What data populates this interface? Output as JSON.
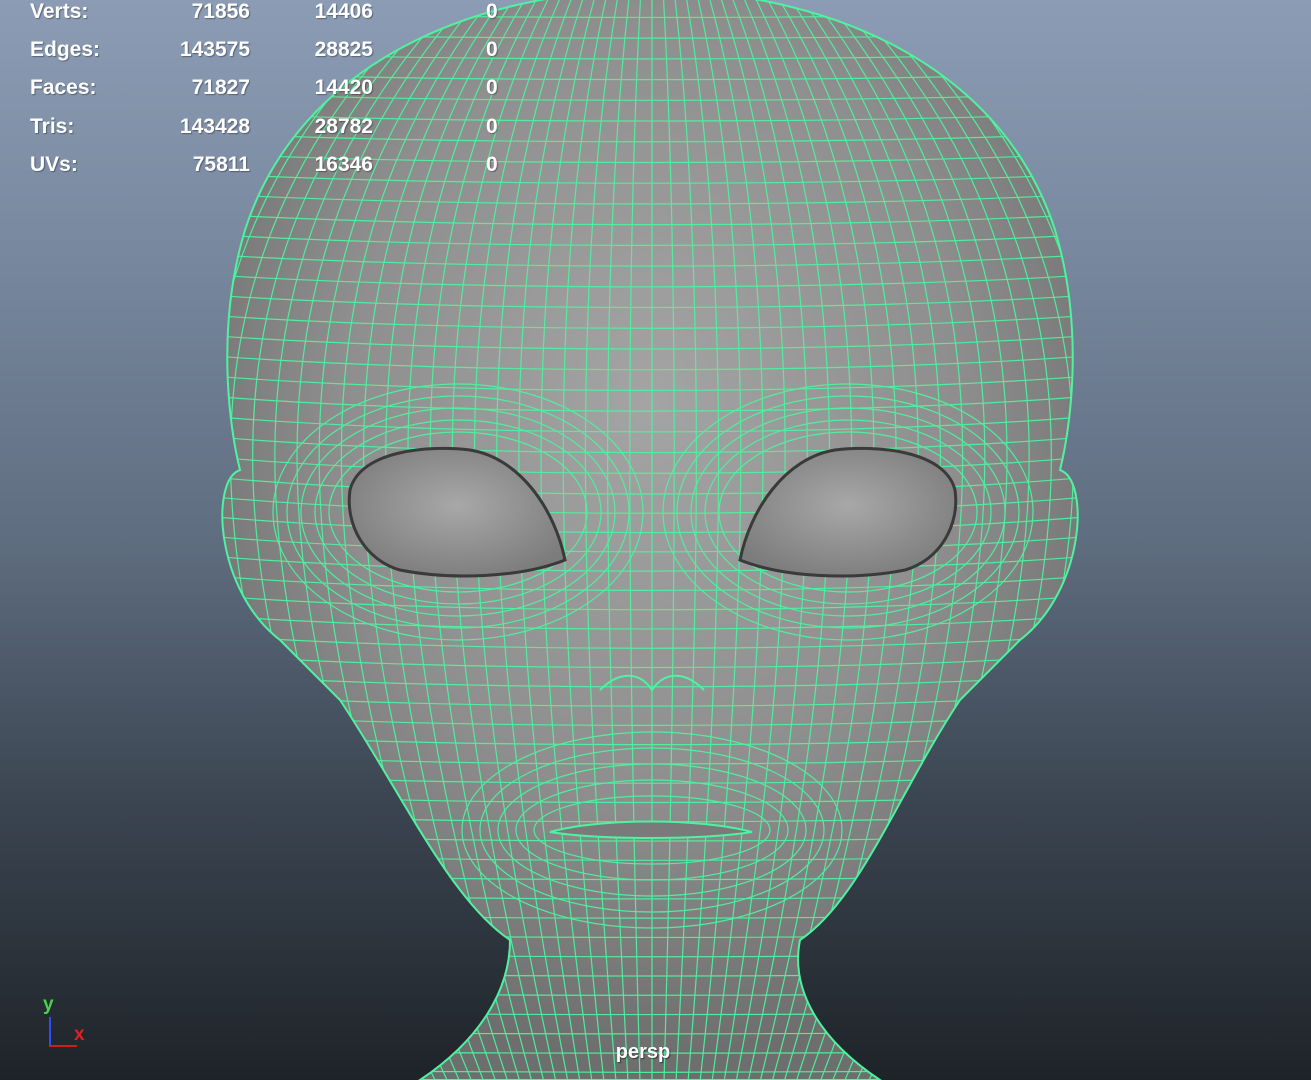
{
  "viewport": {
    "camera": "persp",
    "background_top": "#8b9cb4",
    "background_bottom": "#1e2328",
    "wireframe_color": "#4ff2a0",
    "shaded_color": "#8a8a8a"
  },
  "hud": {
    "rows": [
      {
        "label": "Verts:",
        "total": "71856",
        "selected": "14406",
        "extra": "0"
      },
      {
        "label": "Edges:",
        "total": "143575",
        "selected": "28825",
        "extra": "0"
      },
      {
        "label": "Faces:",
        "total": "71827",
        "selected": "14420",
        "extra": "0"
      },
      {
        "label": "Tris:",
        "total": "143428",
        "selected": "28782",
        "extra": "0"
      },
      {
        "label": "UVs:",
        "total": "75811",
        "selected": "16346",
        "extra": "0"
      }
    ]
  },
  "axis": {
    "y_label": "y",
    "x_label": "x"
  }
}
